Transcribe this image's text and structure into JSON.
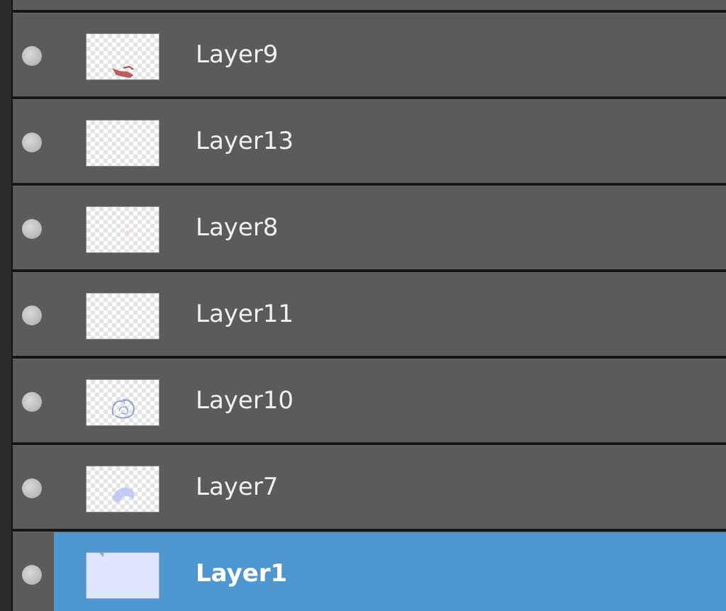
{
  "layers_panel": {
    "layers": [
      {
        "name": "Layer9",
        "thumbnail": "transparent-with-red-brush-mark",
        "visible": true,
        "selected": false
      },
      {
        "name": "Layer13",
        "thumbnail": "transparent-empty",
        "visible": true,
        "selected": false
      },
      {
        "name": "Layer8",
        "thumbnail": "transparent-with-faint-mark",
        "visible": true,
        "selected": false
      },
      {
        "name": "Layer11",
        "thumbnail": "transparent-empty",
        "visible": true,
        "selected": false
      },
      {
        "name": "Layer10",
        "thumbnail": "transparent-with-blue-sketch",
        "visible": true,
        "selected": false
      },
      {
        "name": "Layer7",
        "thumbnail": "transparent-with-blue-shape",
        "visible": true,
        "selected": false
      },
      {
        "name": "Layer1",
        "thumbnail": "solid-light-blue-fill",
        "visible": true,
        "selected": true
      }
    ],
    "colors": {
      "row_background": "#5b5b5b",
      "selected_highlight": "#4f97d0",
      "separator": "#161616",
      "text": "#f1f1f1"
    }
  }
}
